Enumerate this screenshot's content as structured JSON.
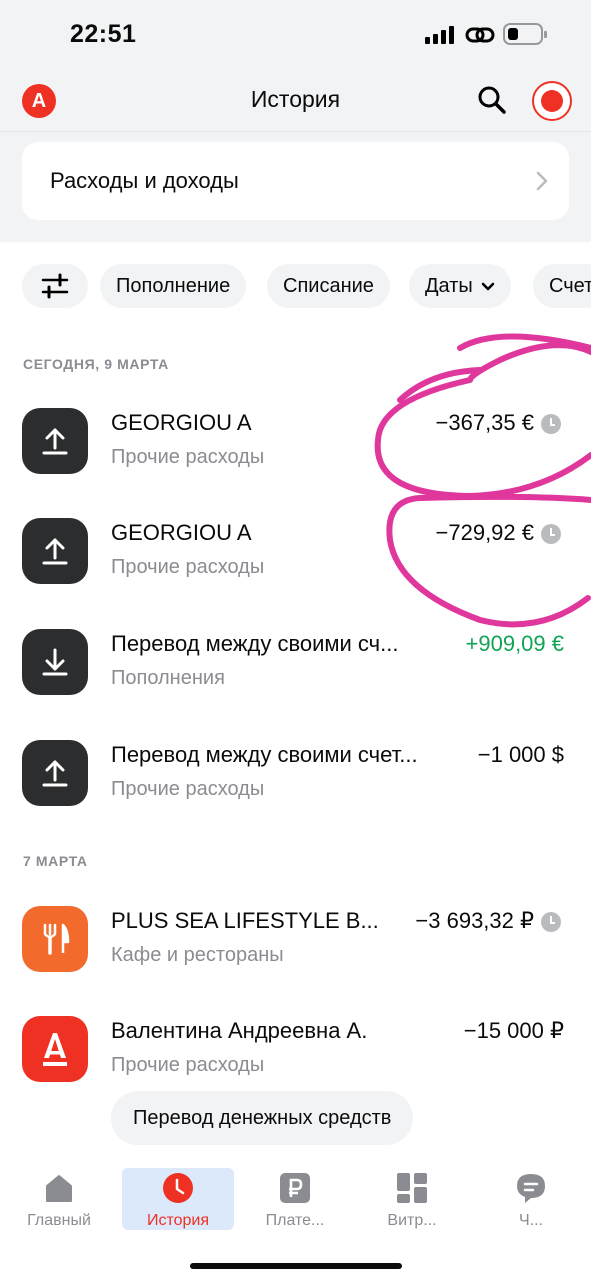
{
  "status_bar": {
    "time": "22:51"
  },
  "header": {
    "title": "История",
    "logo_letter": "А"
  },
  "summary_card": {
    "title": "Расходы и доходы"
  },
  "filters": [
    {
      "label": "Пополнение"
    },
    {
      "label": "Списание"
    },
    {
      "label": "Даты"
    },
    {
      "label": "Счет"
    }
  ],
  "sections": [
    {
      "title": "СЕГОДНЯ, 9 МАРТА",
      "transactions": [
        {
          "title": "GEORGIOU A",
          "subtitle": "Прочие расходы",
          "amount": "−367,35 €",
          "pending": true,
          "icon": "upload-icon"
        },
        {
          "title": "GEORGIOU A",
          "subtitle": "Прочие расходы",
          "amount": "−729,92 €",
          "pending": true,
          "icon": "upload-icon"
        },
        {
          "title": "Перевод между своими сч...",
          "subtitle": "Пополнения",
          "amount": "+909,09 €",
          "pending": false,
          "icon": "download-icon"
        },
        {
          "title": "Перевод между своими счет...",
          "subtitle": "Прочие расходы",
          "amount": "−1 000 $",
          "pending": false,
          "icon": "upload-icon"
        }
      ]
    },
    {
      "title": "7 МАРТА",
      "transactions": [
        {
          "title": "PLUS SEA LIFESTYLE B...",
          "subtitle": "Кафе и рестораны",
          "amount": "−3 693,32 ₽",
          "pending": true,
          "icon": "fork-knife-icon"
        },
        {
          "title": "Валентина Андреевна А.",
          "subtitle": "Прочие расходы",
          "amount": "−15 000 ₽",
          "pending": false,
          "icon": "alfa-logo-icon",
          "tag": "Перевод денежных средств"
        }
      ]
    }
  ],
  "tabbar": [
    {
      "label": "Главный",
      "icon": "home-icon"
    },
    {
      "label": "История",
      "icon": "history-icon",
      "active": true
    },
    {
      "label": "Плате...",
      "icon": "ruble-icon"
    },
    {
      "label": "Витр...",
      "icon": "showcase-icon"
    },
    {
      "label": "Ч...",
      "icon": "chat-icon"
    }
  ],
  "colors": {
    "brand": "#ef3124",
    "income": "#11a456",
    "annotation": "#e0379d"
  }
}
